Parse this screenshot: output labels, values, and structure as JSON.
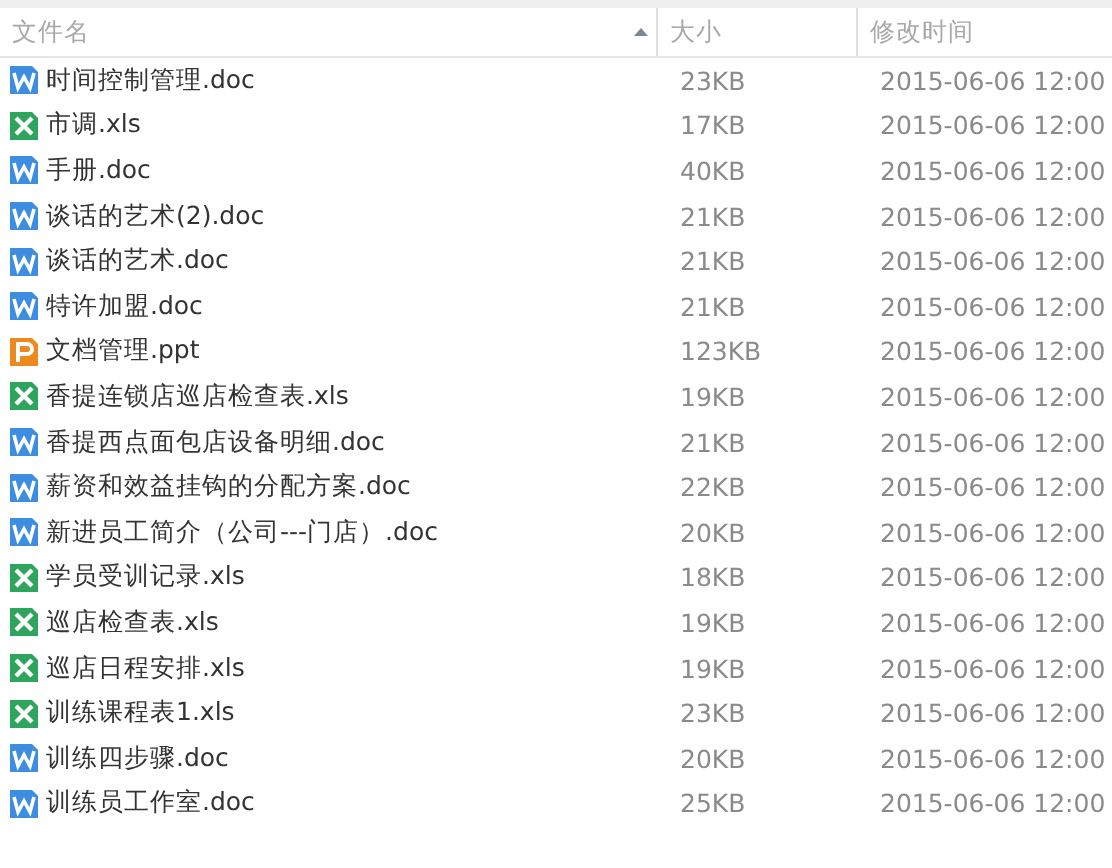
{
  "columns": [
    {
      "label": "文件名",
      "sorted": true
    },
    {
      "label": "大小",
      "sorted": false
    },
    {
      "label": "修改时间",
      "sorted": false
    }
  ],
  "files": [
    {
      "kind": "doc",
      "name": "时间控制管理.doc",
      "size": "23KB",
      "modified": "2015-06-06 12:00"
    },
    {
      "kind": "xls",
      "name": "市调.xls",
      "size": "17KB",
      "modified": "2015-06-06 12:00"
    },
    {
      "kind": "doc",
      "name": "手册.doc",
      "size": "40KB",
      "modified": "2015-06-06 12:00"
    },
    {
      "kind": "doc",
      "name": "谈话的艺术(2).doc",
      "size": "21KB",
      "modified": "2015-06-06 12:00"
    },
    {
      "kind": "doc",
      "name": "谈话的艺术.doc",
      "size": "21KB",
      "modified": "2015-06-06 12:00"
    },
    {
      "kind": "doc",
      "name": "特许加盟.doc",
      "size": "21KB",
      "modified": "2015-06-06 12:00"
    },
    {
      "kind": "ppt",
      "name": "文档管理.ppt",
      "size": "123KB",
      "modified": "2015-06-06 12:00"
    },
    {
      "kind": "xls",
      "name": "香提连锁店巡店检查表.xls",
      "size": "19KB",
      "modified": "2015-06-06 12:00"
    },
    {
      "kind": "doc",
      "name": "香提西点面包店设备明细.doc",
      "size": "21KB",
      "modified": "2015-06-06 12:00"
    },
    {
      "kind": "doc",
      "name": "薪资和效益挂钩的分配方案.doc",
      "size": "22KB",
      "modified": "2015-06-06 12:00"
    },
    {
      "kind": "doc",
      "name": "新进员工简介（公司---门店）.doc",
      "size": "20KB",
      "modified": "2015-06-06 12:00"
    },
    {
      "kind": "xls",
      "name": "学员受训记录.xls",
      "size": "18KB",
      "modified": "2015-06-06 12:00"
    },
    {
      "kind": "xls",
      "name": "巡店检查表.xls",
      "size": "19KB",
      "modified": "2015-06-06 12:00"
    },
    {
      "kind": "xls",
      "name": "巡店日程安排.xls",
      "size": "19KB",
      "modified": "2015-06-06 12:00"
    },
    {
      "kind": "xls",
      "name": "训练课程表1.xls",
      "size": "23KB",
      "modified": "2015-06-06 12:00"
    },
    {
      "kind": "doc",
      "name": "训练四步骤.doc",
      "size": "20KB",
      "modified": "2015-06-06 12:00"
    },
    {
      "kind": "doc",
      "name": "训练员工作室.doc",
      "size": "25KB",
      "modified": "2015-06-06 12:00"
    }
  ]
}
